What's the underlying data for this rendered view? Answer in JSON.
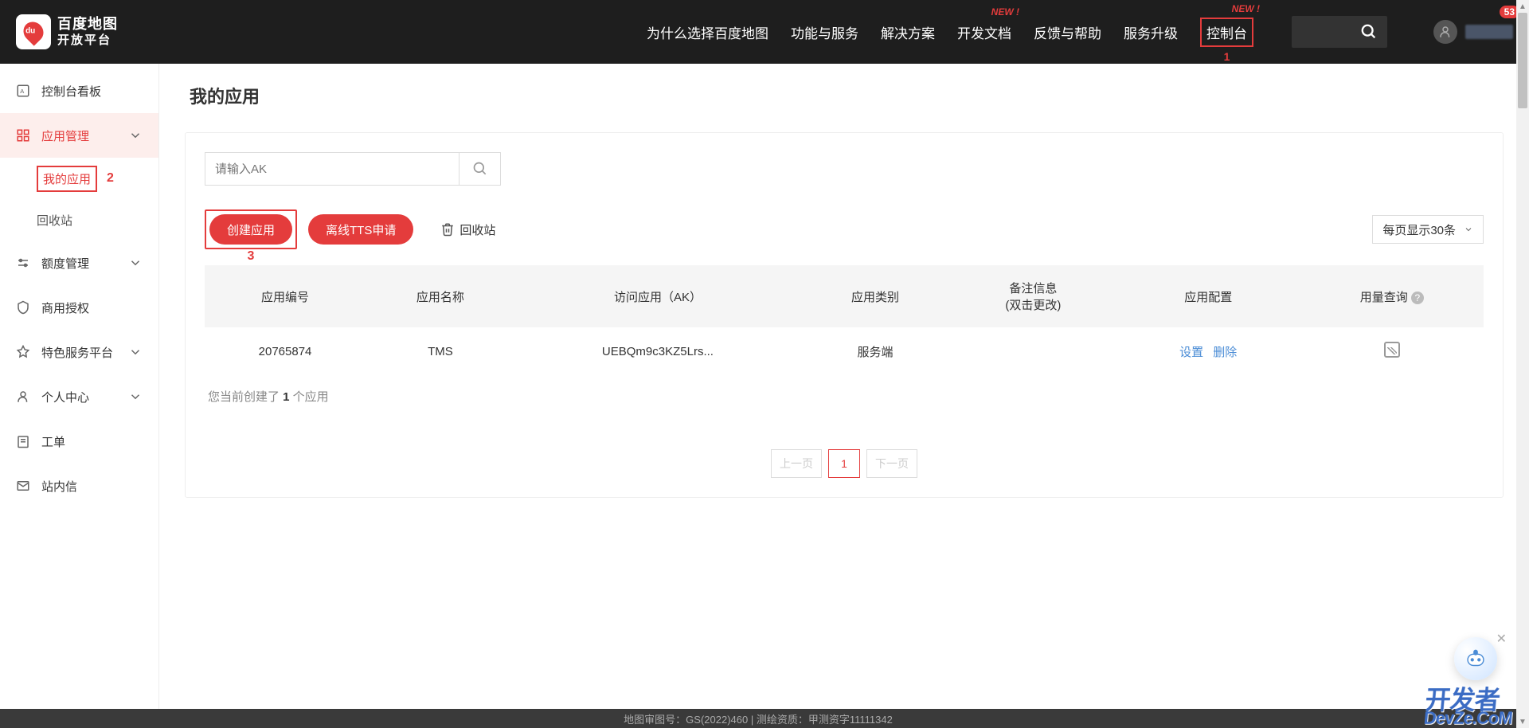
{
  "header": {
    "logo_title": "百度地图",
    "logo_subtitle": "开放平台",
    "nav": [
      {
        "label": "为什么选择百度地图",
        "badge": ""
      },
      {
        "label": "功能与服务",
        "badge": ""
      },
      {
        "label": "解决方案",
        "badge": ""
      },
      {
        "label": "开发文档",
        "badge": "NEW !"
      },
      {
        "label": "反馈与帮助",
        "badge": ""
      },
      {
        "label": "服务升级",
        "badge": ""
      },
      {
        "label": "控制台",
        "badge": "NEW !"
      }
    ],
    "console_annotation": "1",
    "notif_count": "53"
  },
  "sidebar": {
    "items": [
      {
        "icon": "dashboard",
        "label": "控制台看板",
        "expandable": false
      },
      {
        "icon": "grid",
        "label": "应用管理",
        "expandable": true,
        "active": true
      },
      {
        "icon": "quota",
        "label": "额度管理",
        "expandable": true
      },
      {
        "icon": "shield",
        "label": "商用授权",
        "expandable": false
      },
      {
        "icon": "tag",
        "label": "特色服务平台",
        "expandable": true
      },
      {
        "icon": "user",
        "label": "个人中心",
        "expandable": true
      },
      {
        "icon": "ticket",
        "label": "工单",
        "expandable": false
      },
      {
        "icon": "mail",
        "label": "站内信",
        "expandable": false
      }
    ],
    "sub_items": [
      {
        "label": "我的应用",
        "highlight": true,
        "annotation": "2"
      },
      {
        "label": "回收站",
        "highlight": false
      }
    ]
  },
  "main": {
    "title": "我的应用",
    "ak_placeholder": "请输入AK",
    "create_btn": "创建应用",
    "create_annotation": "3",
    "tts_btn": "离线TTS申请",
    "recycle_link": "回收站",
    "page_size_label": "每页显示30条",
    "table_headers": [
      "应用编号",
      "应用名称",
      "访问应用（AK）",
      "应用类别",
      "备注信息\n(双击更改)",
      "应用配置",
      "用量查询"
    ],
    "table_row": {
      "id": "20765874",
      "name": "TMS",
      "ak": "UEBQm9c3KZ5Lrs...",
      "type": "服务端",
      "remark": "",
      "config_set": "设置",
      "config_del": "删除"
    },
    "summary_prefix": "您当前创建了 ",
    "summary_count": "1",
    "summary_suffix": " 个应用",
    "pagination": {
      "prev": "上一页",
      "current": "1",
      "next": "下一页"
    }
  },
  "footer": {
    "text": "地图审图号：GS(2022)460 | 测绘资质：甲测资字11111342"
  },
  "watermark": {
    "line1": "开发者",
    "line2": "DevZe.CoM"
  }
}
